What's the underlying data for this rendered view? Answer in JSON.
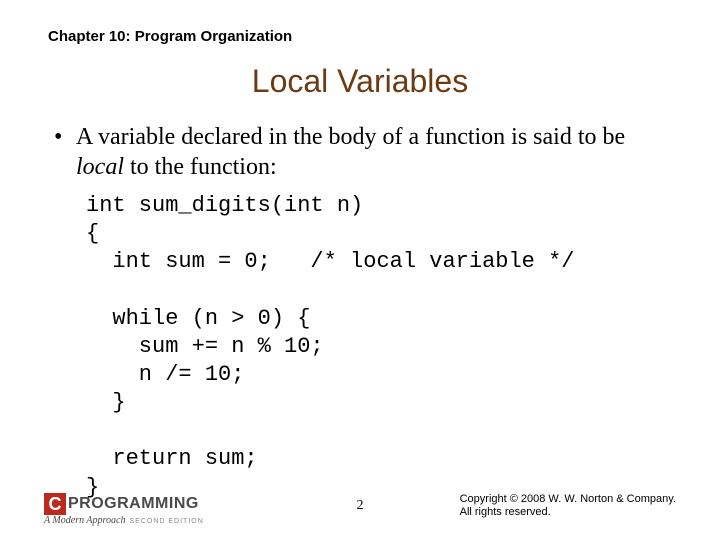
{
  "chapter": "Chapter 10: Program Organization",
  "title": "Local Variables",
  "bullet": {
    "pre": "A variable declared in the body of a function is said to be ",
    "emph": "local",
    "post": " to the function:"
  },
  "code": "int sum_digits(int n)\n{\n  int sum = 0;   /* local variable */\n\n  while (n > 0) {\n    sum += n % 10;\n    n /= 10;\n  }\n\n  return sum;\n}",
  "logo": {
    "c": "C",
    "word": "PROGRAMMING",
    "sub": "A Modern Approach",
    "edition": "SECOND EDITION"
  },
  "page_number": "2",
  "copyright_line1": "Copyright © 2008 W. W. Norton & Company.",
  "copyright_line2": "All rights reserved."
}
